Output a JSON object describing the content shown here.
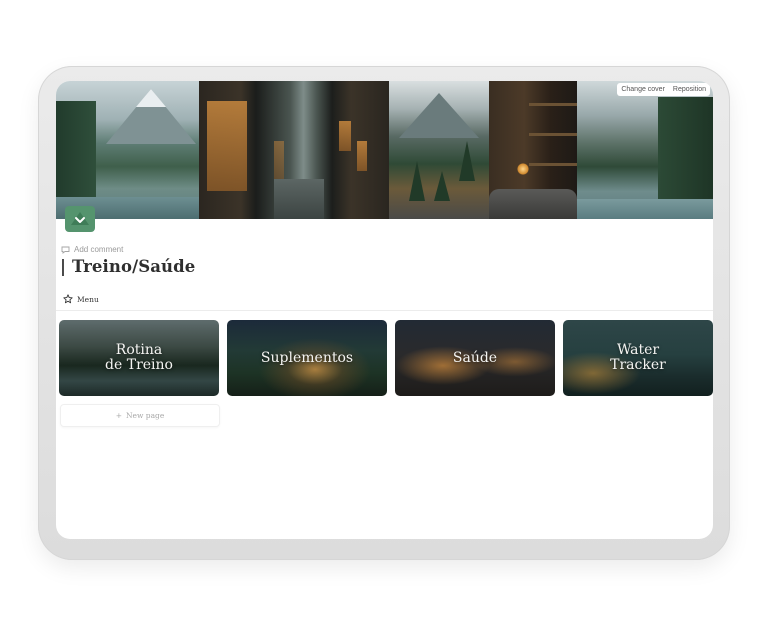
{
  "cover": {
    "change_label": "Change cover",
    "reposition_label": "Reposition"
  },
  "page_icon": {
    "name": "green-mountain-check-icon",
    "color": "#55946e"
  },
  "add_comment": "Add comment",
  "title": "| Treino/Saúde",
  "view_tab": {
    "label": "Menu",
    "icon": "star-icon"
  },
  "gallery": {
    "cards": [
      {
        "label": "Rotina\nde Treino"
      },
      {
        "label": "Suplementos"
      },
      {
        "label": "Saúde"
      },
      {
        "label": "Water\nTracker"
      }
    ],
    "new_page_label": "New page"
  }
}
